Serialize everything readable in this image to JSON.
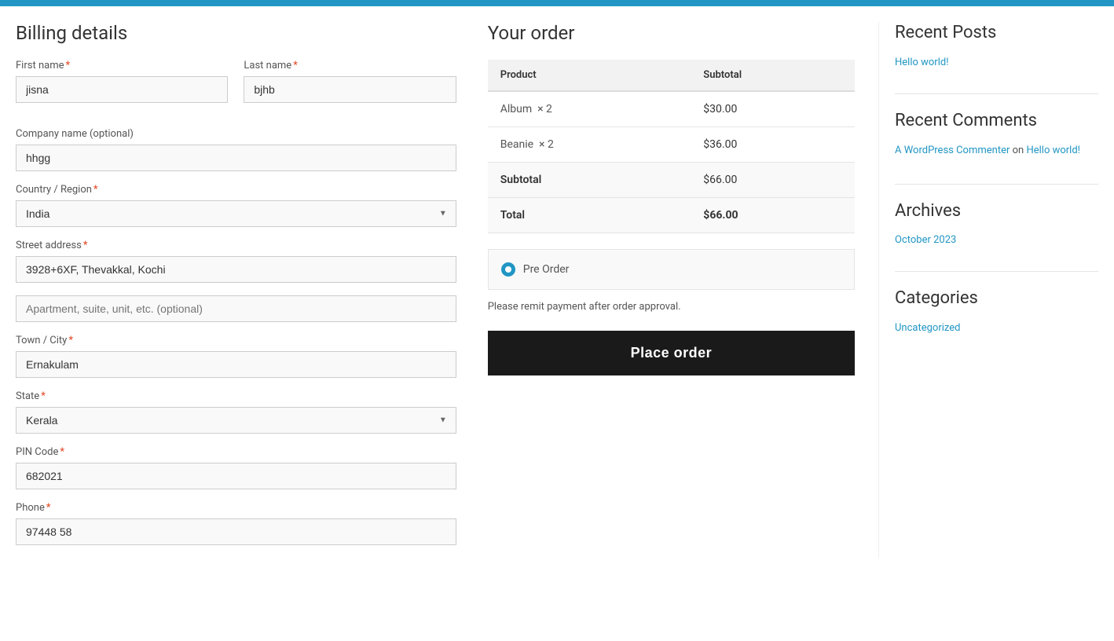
{
  "topbar": {
    "color": "#2196c4"
  },
  "billing": {
    "title": "Billing details",
    "fields": {
      "first_name_label": "First name",
      "first_name_value": "jisna",
      "last_name_label": "Last name",
      "last_name_value": "bjhb",
      "company_name_label": "Company name (optional)",
      "company_name_value": "hhgg",
      "country_label": "Country / Region",
      "country_value": "India",
      "street_label": "Street address",
      "street_value": "3928+6XF, Thevakkal, Kochi",
      "apt_placeholder": "Apartment, suite, unit, etc. (optional)",
      "apt_value": "",
      "city_label": "Town / City",
      "city_value": "Ernakulam",
      "state_label": "State",
      "state_value": "Kerala",
      "pin_label": "PIN Code",
      "pin_value": "682021",
      "phone_label": "Phone",
      "phone_value": "97448 58"
    }
  },
  "order": {
    "title": "Your order",
    "col_product": "Product",
    "col_subtotal": "Subtotal",
    "items": [
      {
        "name": "Album",
        "qty": "× 2",
        "price": "$30.00"
      },
      {
        "name": "Beanie",
        "qty": "× 2",
        "price": "$36.00"
      }
    ],
    "subtotal_label": "Subtotal",
    "subtotal_value": "$66.00",
    "total_label": "Total",
    "total_value": "$66.00",
    "payment_label": "Pre Order",
    "payment_note": "Please remit payment after order approval.",
    "place_order_btn": "Place order"
  },
  "sidebar": {
    "recent_posts_heading": "Recent Posts",
    "recent_posts": [
      {
        "label": "Hello world!",
        "url": "#"
      }
    ],
    "recent_comments_heading": "Recent Comments",
    "commenter": "A WordPress Commenter",
    "on_text": "on",
    "comment_post": "Hello world!",
    "archives_heading": "Archives",
    "archives": [
      {
        "label": "October 2023",
        "url": "#"
      }
    ],
    "categories_heading": "Categories",
    "categories": [
      {
        "label": "Uncategorized",
        "url": "#"
      }
    ]
  }
}
